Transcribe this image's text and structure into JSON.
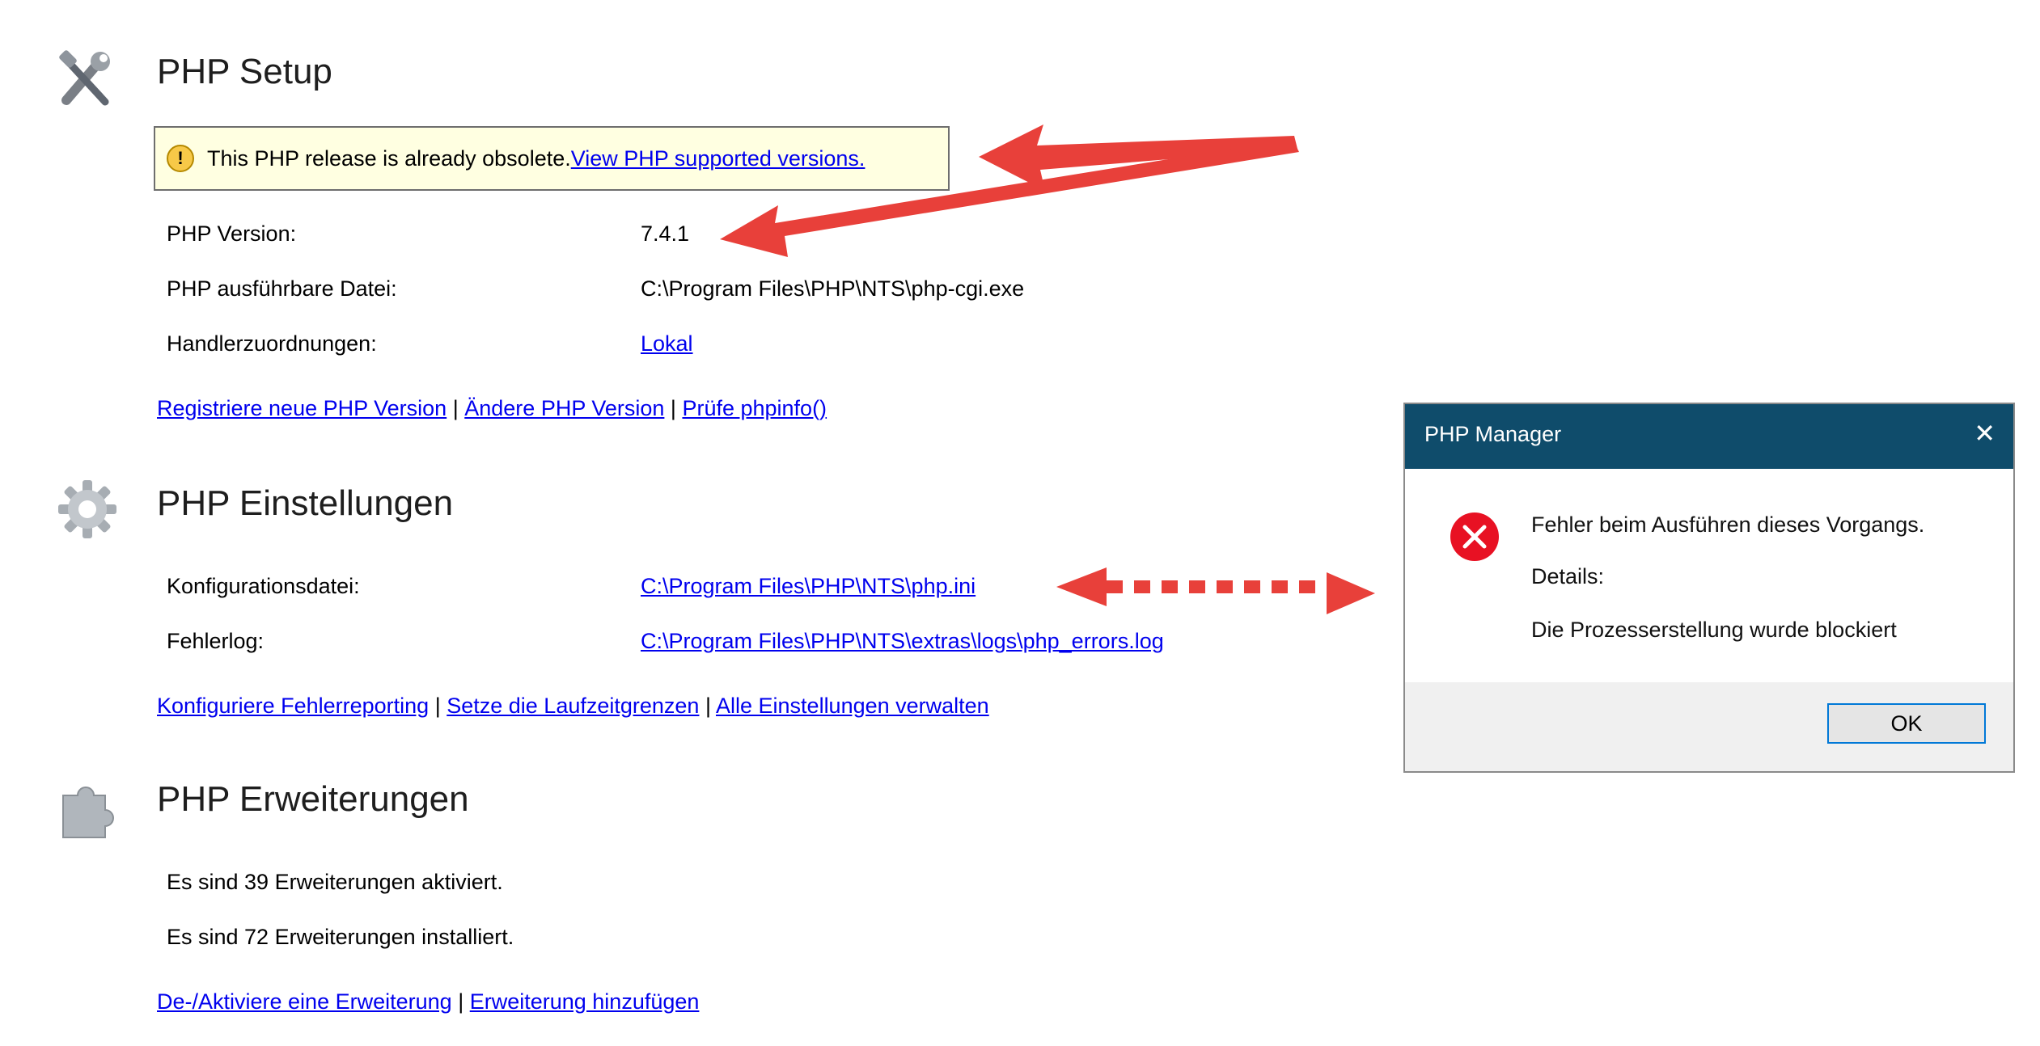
{
  "setup": {
    "title": "PHP Setup",
    "warning_text": "This PHP release is already obsolete.",
    "warning_link": "View PHP supported versions.",
    "version_label": "PHP Version:",
    "version_value": "7.4.1",
    "exe_label": "PHP ausführbare Datei:",
    "exe_value": "C:\\Program Files\\PHP\\NTS\\php-cgi.exe",
    "handler_label": "Handlerzuordnungen:",
    "handler_value": "Lokal",
    "links": [
      "Registriere neue PHP Version",
      "Ändere PHP Version",
      "Prüfe phpinfo()"
    ]
  },
  "settings": {
    "title": "PHP Einstellungen",
    "config_label": "Konfigurationsdatei:",
    "config_value": "C:\\Program Files\\PHP\\NTS\\php.ini",
    "errorlog_label": "Fehlerlog:",
    "errorlog_value": "C:\\Program Files\\PHP\\NTS\\extras\\logs\\php_errors.log",
    "links": [
      "Konfiguriere Fehlerreporting",
      "Setze die Laufzeitgrenzen",
      "Alle Einstellungen verwalten"
    ]
  },
  "extensions": {
    "title": "PHP Erweiterungen",
    "enabled_text": "Es sind 39 Erweiterungen aktiviert.",
    "installed_text": "Es sind 72 Erweiterungen installiert.",
    "links": [
      "De-/Aktiviere eine Erweiterung",
      "Erweiterung hinzufügen"
    ]
  },
  "separator": "|",
  "dialog": {
    "title": "PHP Manager",
    "close_glyph": "✕",
    "message": "Fehler beim Ausführen dieses Vorgangs.",
    "details_label": "Details:",
    "details_text": "Die Prozesserstellung wurde blockiert",
    "ok_label": "OK"
  },
  "colors": {
    "link": "#0000ee",
    "annotation_arrow": "#e8403a",
    "dialog_titlebar": "#0f4c6b",
    "error_icon": "#e81123",
    "warning_bg": "#ffffe1"
  },
  "icons": {
    "setup": "tools-icon",
    "settings": "gear-icon",
    "extensions": "puzzle-icon",
    "warning": "warning-icon",
    "error": "error-icon"
  }
}
